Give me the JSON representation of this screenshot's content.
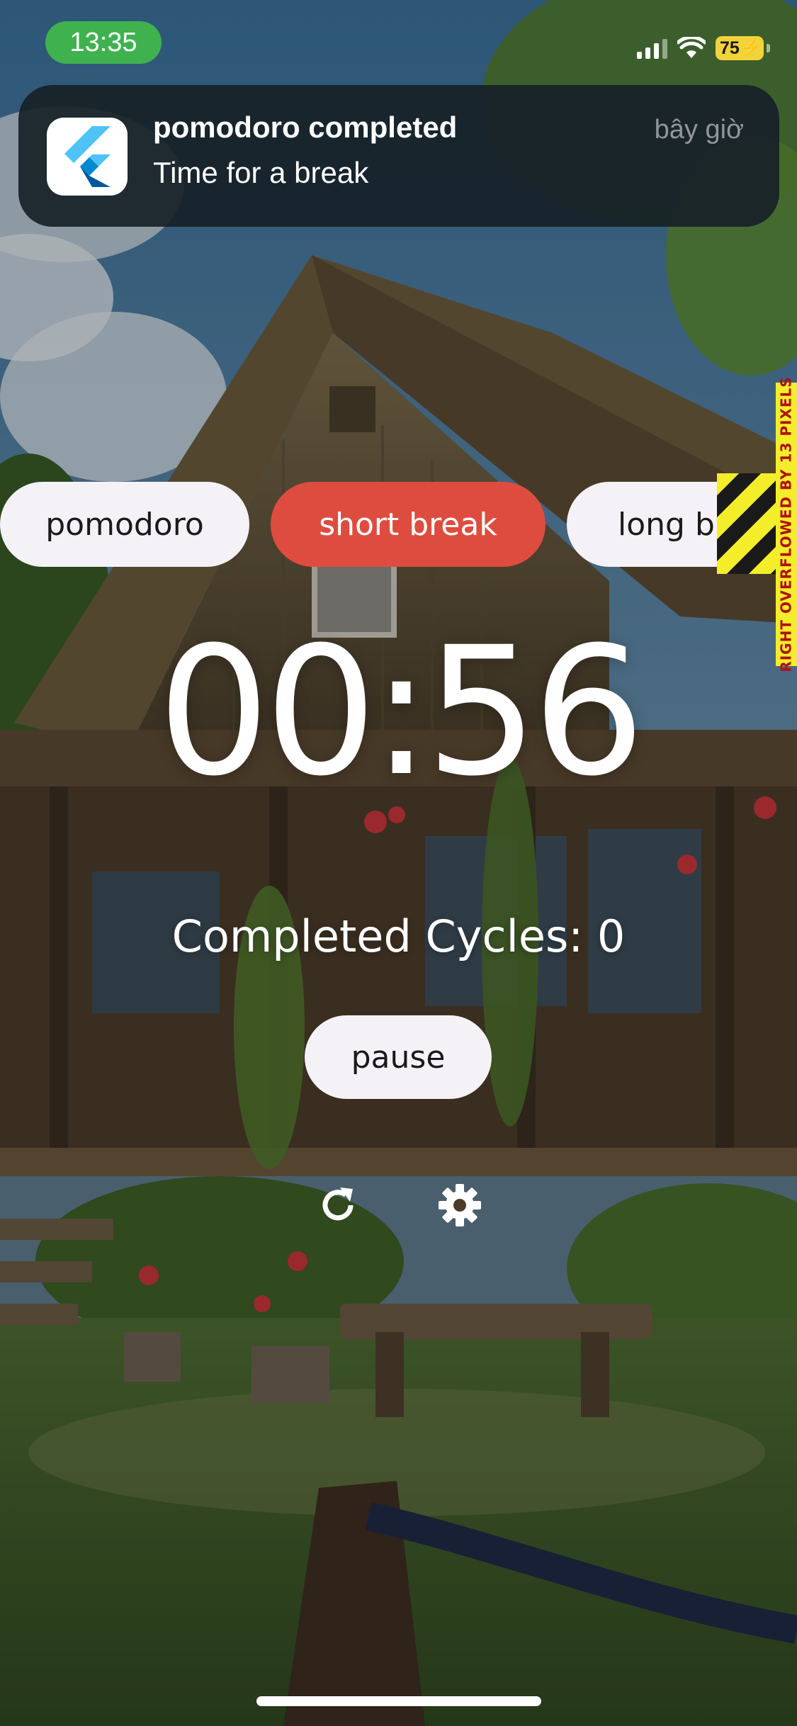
{
  "status_bar": {
    "time": "13:35",
    "battery": "75",
    "colors": {
      "time_pill": "#3fb24f",
      "battery": "#f2d33a"
    }
  },
  "notification": {
    "app_icon": "flutter-icon",
    "title": "pomodoro completed",
    "body": "Time for a break",
    "time": "bây giờ"
  },
  "modes": {
    "items": [
      {
        "label": "pomodoro",
        "active": false
      },
      {
        "label": "short break",
        "active": true
      },
      {
        "label": "long break",
        "active": false
      }
    ],
    "active_color": "#de4c40"
  },
  "debug_overflow": {
    "message": "RIGHT OVERFLOWED BY 13 PIXELS"
  },
  "timer": {
    "display": "00:56"
  },
  "cycles": {
    "label": "Completed Cycles:",
    "count": "0"
  },
  "controls": {
    "pause_label": "pause",
    "reset_icon": "refresh-icon",
    "settings_icon": "gear-icon"
  }
}
